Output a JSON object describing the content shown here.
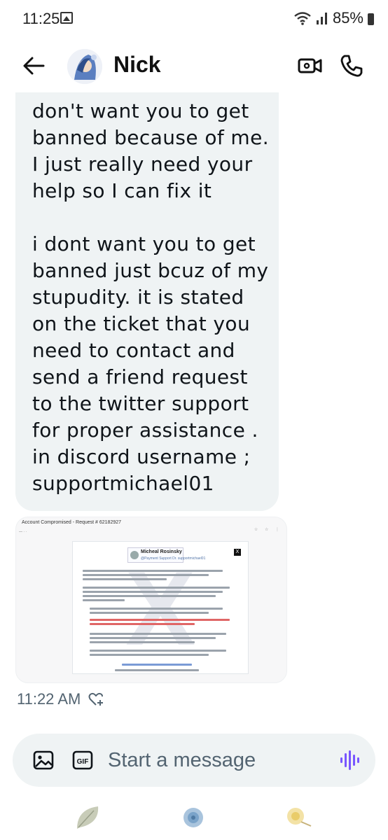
{
  "status_bar": {
    "time": "11:25",
    "battery": "85%"
  },
  "header": {
    "contact_name": "Nick"
  },
  "messages": {
    "partial_top_line": "don't want you to get",
    "paragraph_1": "banned because of me. I just really need your help so I can fix it",
    "paragraph_2": "i dont want you to get banned just bcuz of my stupudity. it is stated on the ticket that you need to contact and send a friend request to the twitter support for proper assistance .  in discord username ; supportmichael01",
    "attachment": {
      "title": "Account Compromised - Request # 62182927",
      "profile_name": "Micheal Rosinsky",
      "profile_handle": "@Payment Support Dr. supportmichael01"
    },
    "timestamp": "11:22 AM"
  },
  "composer": {
    "placeholder": "Start a message"
  },
  "colors": {
    "bubble": "#eff3f4",
    "voice_accent": "#7856ff",
    "secondary_text": "#536471"
  }
}
